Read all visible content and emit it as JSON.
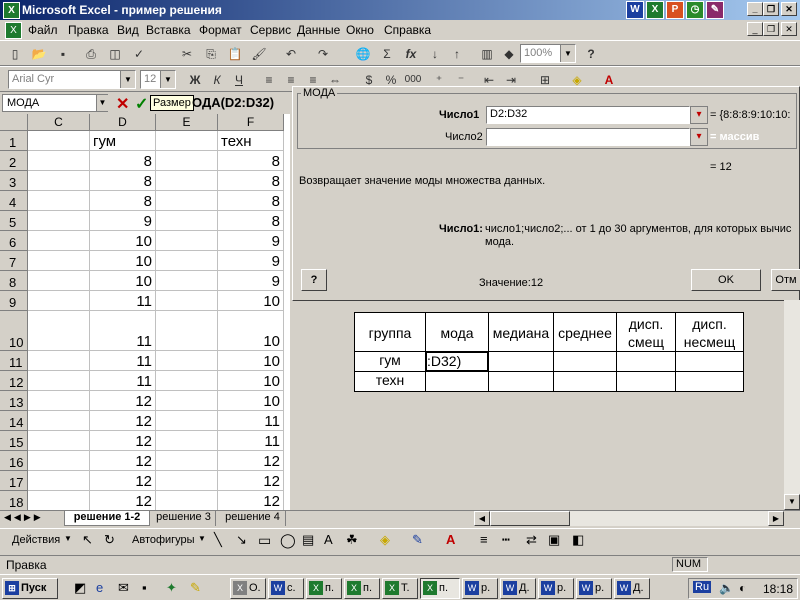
{
  "window": {
    "title": "Microsoft Excel - пример решения"
  },
  "menu": [
    "Файл",
    "Правка",
    "Вид",
    "Вставка",
    "Формат",
    "Сервис",
    "Данные",
    "Окно",
    "Справка"
  ],
  "toolbar": {
    "zoom": "100%",
    "font": "Arial Cyr",
    "size": "12"
  },
  "formula_bar": {
    "name_box": "МОДА",
    "tooltip": "Размер",
    "formula": "ОДА(D2:D32)"
  },
  "columns": [
    "C",
    "D",
    "E",
    "F"
  ],
  "rows": [
    {
      "n": "1",
      "d": "гум",
      "f": "техн"
    },
    {
      "n": "2",
      "d": "8",
      "f": "8"
    },
    {
      "n": "3",
      "d": "8",
      "f": "8"
    },
    {
      "n": "4",
      "d": "8",
      "f": "8"
    },
    {
      "n": "5",
      "d": "9",
      "f": "8"
    },
    {
      "n": "6",
      "d": "10",
      "f": "9"
    },
    {
      "n": "7",
      "d": "10",
      "f": "9"
    },
    {
      "n": "8",
      "d": "10",
      "f": "9"
    },
    {
      "n": "9",
      "d": "11",
      "f": "10"
    },
    {
      "n": "10",
      "d": "11",
      "f": "10"
    },
    {
      "n": "11",
      "d": "11",
      "f": "10"
    },
    {
      "n": "12",
      "d": "11",
      "f": "10"
    },
    {
      "n": "13",
      "d": "12",
      "f": "10"
    },
    {
      "n": "14",
      "d": "12",
      "f": "11"
    },
    {
      "n": "15",
      "d": "12",
      "f": "11"
    },
    {
      "n": "16",
      "d": "12",
      "f": "12"
    },
    {
      "n": "17",
      "d": "12",
      "f": "12"
    },
    {
      "n": "18",
      "d": "12",
      "f": "12"
    }
  ],
  "dialog": {
    "title": "МОДА",
    "arg1_label": "Число1",
    "arg1_value": "D2:D32",
    "arg1_result": "= {8:8:8:9:10:10:",
    "arg2_label": "Число2",
    "arg2_result": "= массив",
    "result": "= 12",
    "description": "Возвращает значение моды множества данных.",
    "arg_help_label": "Число1:",
    "arg_help_text": "число1;число2;... от 1 до 30 аргументов, для которых вычис",
    "arg_help_text2": "мода.",
    "value_text": "Значение:12",
    "ok": "OK",
    "cancel": "Отм"
  },
  "stats_table": {
    "headers": [
      "группа",
      "мода",
      "медиана",
      "среднее",
      "дисп. смещ",
      "дисп. несмещ"
    ],
    "rows": [
      [
        "гум",
        ":D32)",
        "",
        "",
        "",
        ""
      ],
      [
        "техн",
        "",
        "",
        "",
        "",
        ""
      ]
    ]
  },
  "sheet_tabs": [
    "решение 1-2",
    "решение 3",
    "решение 4"
  ],
  "drawing": {
    "actions": "Действия",
    "autoshapes": "Автофигуры"
  },
  "status": {
    "left": "Правка",
    "right": "NUM"
  },
  "taskbar": {
    "start": "Пуск",
    "tasks": [
      "О.",
      "с.",
      "п.",
      "п.",
      "Т.",
      "п.",
      "р.",
      "Д.",
      "р.",
      "р.",
      "Д."
    ],
    "lang": "Ru",
    "time": "18:18"
  }
}
